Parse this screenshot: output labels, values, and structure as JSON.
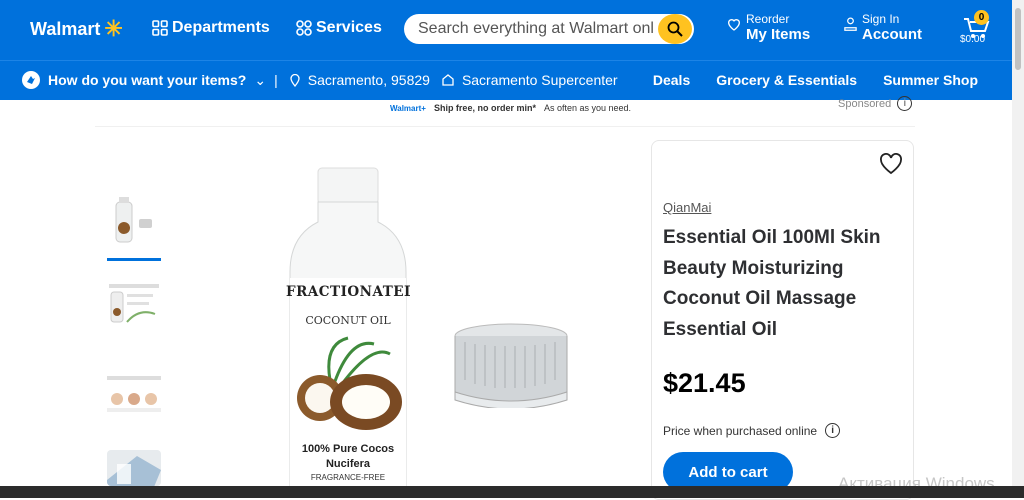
{
  "header": {
    "logo": "Walmart",
    "departments": "Departments",
    "services": "Services",
    "search_placeholder": "Search everything at Walmart online and in store",
    "reorder_small": "Reorder",
    "reorder_big": "My Items",
    "signin_small": "Sign In",
    "signin_big": "Account",
    "cart_count": "0",
    "cart_total": "$0.00"
  },
  "subbar": {
    "question": "How do you want your items?",
    "separator": "|",
    "location": "Sacramento, 95829",
    "store": "Sacramento Supercenter",
    "links": [
      "Deals",
      "Grocery & Essentials",
      "Summer Shop"
    ]
  },
  "promo": {
    "logo": "Walmart+",
    "headline": "Ship free, no order min*",
    "sub": "As often as you need."
  },
  "sponsored": "Sponsored",
  "product": {
    "brand": "QianMai",
    "title": "Essential Oil 100Ml Skin Beauty Moisturizing Coconut Oil Massage Essential Oil",
    "price": "$21.45",
    "price_note": "Price when purchased online",
    "add_to_cart": "Add to cart",
    "label_line1": "FRACTIONATED",
    "label_line2": "COCONUT OIL",
    "label_line3": "100% Pure Cocos",
    "label_line4": "Nucifera",
    "label_line5": "FRAGRANCE-FREE"
  },
  "watermark": "Активация Windows",
  "colors": {
    "primary": "#0071dc",
    "accent": "#ffc220"
  }
}
